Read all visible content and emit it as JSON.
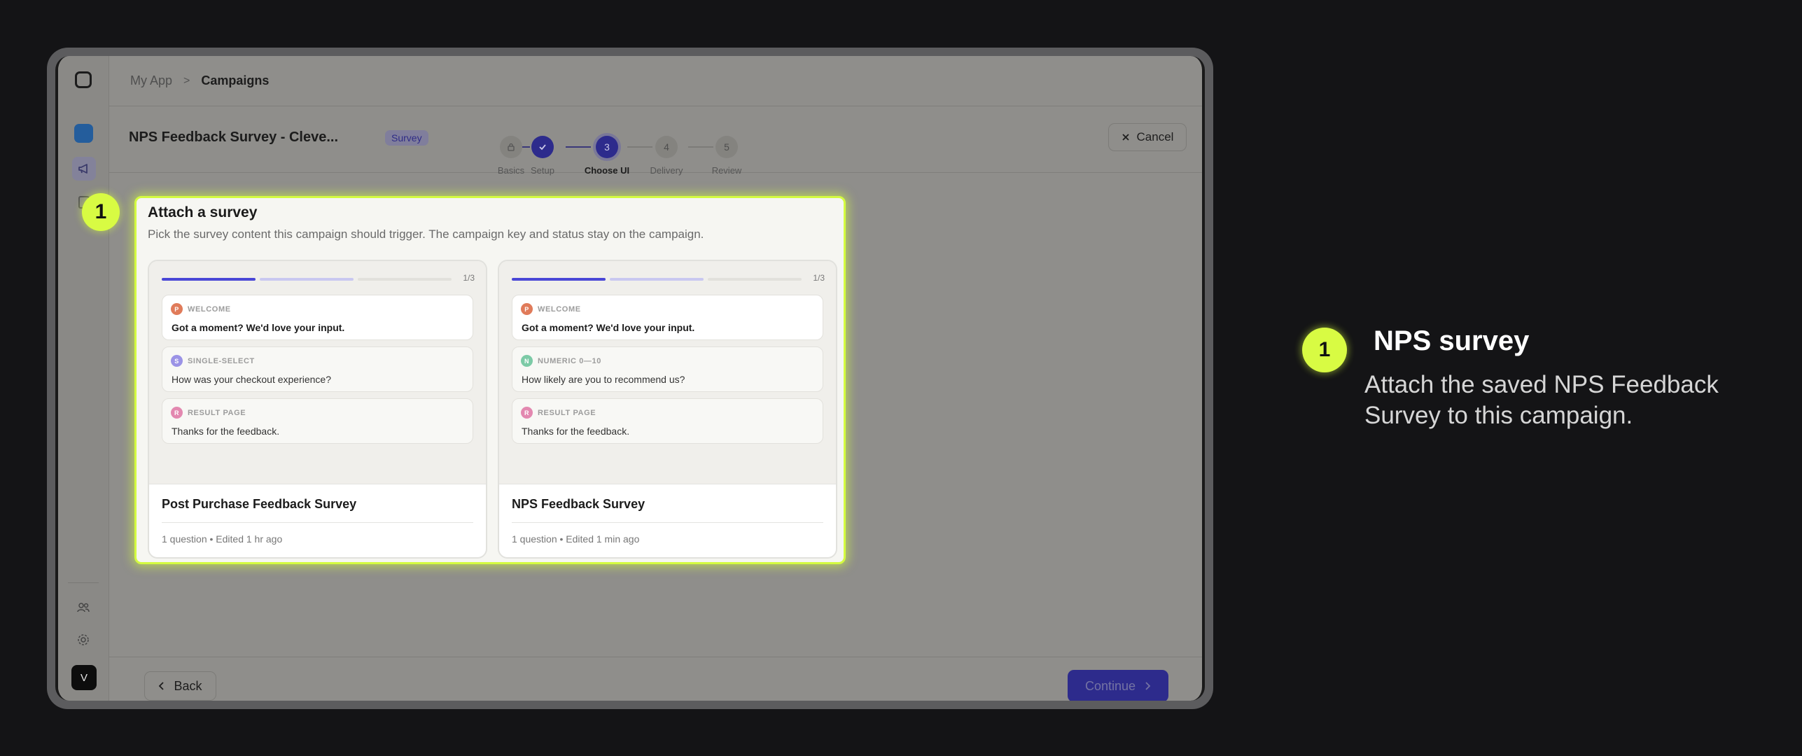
{
  "breadcrumb": {
    "app": "My App",
    "separator": ">",
    "current": "Campaigns"
  },
  "campaign": {
    "title": "NPS Feedback Survey - Cleve...",
    "badge": "Survey"
  },
  "steps": [
    {
      "number": "1",
      "label": "Basics",
      "state": "done"
    },
    {
      "number": "2",
      "label": "Setup",
      "state": "done"
    },
    {
      "number": "3",
      "label": "Choose UI",
      "state": "active"
    },
    {
      "number": "4",
      "label": "Delivery",
      "state": "pending"
    },
    {
      "number": "5",
      "label": "Review",
      "state": "pending"
    }
  ],
  "cancel_label": "Cancel",
  "panel": {
    "title": "Attach a survey",
    "subtitle": "Pick the survey content this campaign should trigger. The campaign key and status stay on the campaign."
  },
  "cards": [
    {
      "name": "Post Purchase Feedback Survey",
      "meta": "1 question • Edited 1 hr ago",
      "progress_count": "1/3",
      "progress_fraction": 0.333,
      "questions": [
        {
          "type": "WELCOME",
          "text": "Got a moment? We'd love your input.",
          "dot_color": "#e07b5a",
          "dot_letter": "P"
        },
        {
          "type": "SINGLE-SELECT",
          "text": "How was your checkout experience?",
          "dot_color": "#9b93e6",
          "dot_letter": "S"
        },
        {
          "type": "RESULT PAGE",
          "text": "Thanks for the feedback.",
          "dot_color": "#e388b0",
          "dot_letter": "R"
        }
      ]
    },
    {
      "name": "NPS Feedback Survey",
      "meta": "1 question • Edited 1 min ago",
      "progress_count": "1/3",
      "progress_fraction": 0.333,
      "questions": [
        {
          "type": "WELCOME",
          "text": "Got a moment? We'd love your input.",
          "dot_color": "#e07b5a",
          "dot_letter": "P"
        },
        {
          "type": "NUMERIC 0—10",
          "text": "How likely are you to recommend us?",
          "dot_color": "#7ccaa6",
          "dot_letter": "N"
        },
        {
          "type": "RESULT PAGE",
          "text": "Thanks for the feedback.",
          "dot_color": "#e388b0",
          "dot_letter": "R"
        }
      ]
    }
  ],
  "footer": {
    "back_label": "Back",
    "continue_label": "Continue"
  },
  "sidebar": {
    "avatar_letter": "V"
  },
  "annotation": {
    "marker_number": "1",
    "title": "NPS survey",
    "description": "Attach the saved NPS Feedback Survey to this campaign."
  },
  "colors": {
    "highlight": "#d8fb43",
    "accent": "#2d2b8c",
    "progress_active": "#4a47d6"
  }
}
